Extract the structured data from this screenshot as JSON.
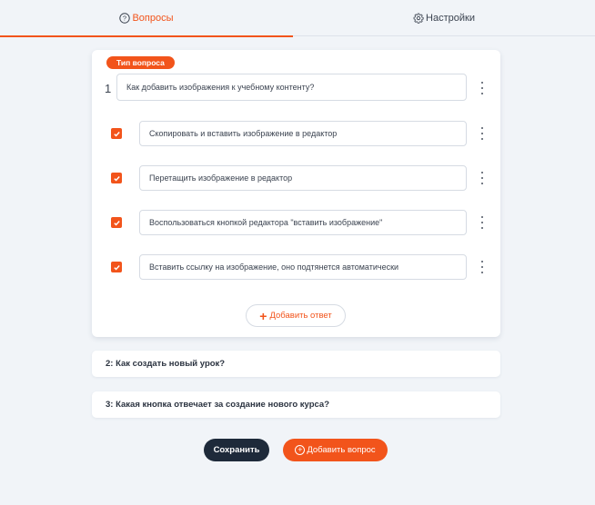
{
  "tabs": {
    "questions": {
      "label": "Вопросы",
      "icon": "question-circle-icon"
    },
    "settings": {
      "label": "Настройки",
      "icon": "gear-icon"
    }
  },
  "colors": {
    "accent": "#f2541b",
    "dark": "#1e2a3a",
    "background": "#f1f4f8"
  },
  "question_card": {
    "type_badge": "Тип вопроса",
    "number": "1",
    "question_text": "Как добавить изображения к учебному контенту?",
    "answers": [
      {
        "text": "Скопировать и вставить изображение в редактор",
        "checked": true
      },
      {
        "text": "Перетащить изображение в редактор",
        "checked": true
      },
      {
        "text": "Воспользоваться кнопкой редактора \"вставить изображение\"",
        "checked": true
      },
      {
        "text": "Вставить ссылку на изображение, оно подтянется автоматически",
        "checked": true
      }
    ],
    "add_answer_label": "Добавить ответ"
  },
  "collapsed_questions": [
    {
      "title": "2: Как создать новый урок?"
    },
    {
      "title": "3: Какая кнопка отвечает за создание нового курса?"
    }
  ],
  "footer": {
    "save_label": "Сохранить",
    "add_question_label": "Добавить вопрос"
  }
}
